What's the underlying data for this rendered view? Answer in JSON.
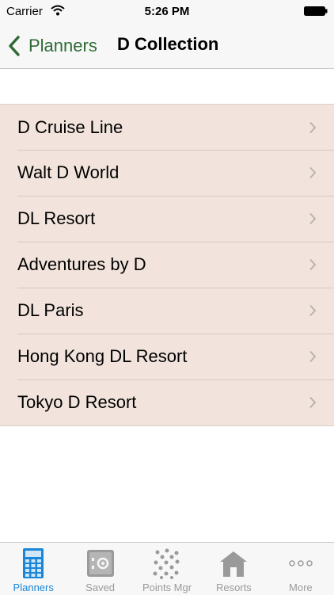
{
  "status_bar": {
    "carrier": "Carrier",
    "time": "5:26 PM"
  },
  "nav": {
    "back_label": "Planners",
    "title": "D Collection"
  },
  "list": {
    "items": [
      {
        "label": "D Cruise Line"
      },
      {
        "label": "Walt D World"
      },
      {
        "label": "DL Resort"
      },
      {
        "label": "Adventures by D"
      },
      {
        "label": "DL Paris"
      },
      {
        "label": "Hong Kong DL Resort"
      },
      {
        "label": "Tokyo D Resort"
      }
    ]
  },
  "tabbar": {
    "active": "Planners",
    "items": [
      {
        "label": "Planners",
        "icon": "calculator-icon"
      },
      {
        "label": "Saved",
        "icon": "safe-icon"
      },
      {
        "label": "Points Mgr",
        "icon": "dots-icon"
      },
      {
        "label": "Resorts",
        "icon": "house-icon"
      },
      {
        "label": "More",
        "icon": "more-icon"
      }
    ]
  },
  "colors": {
    "accent_green": "#2e6b34",
    "list_bg": "#f2e4dc",
    "tab_active": "#1a86d9",
    "tab_inactive": "#9a9a9a"
  }
}
